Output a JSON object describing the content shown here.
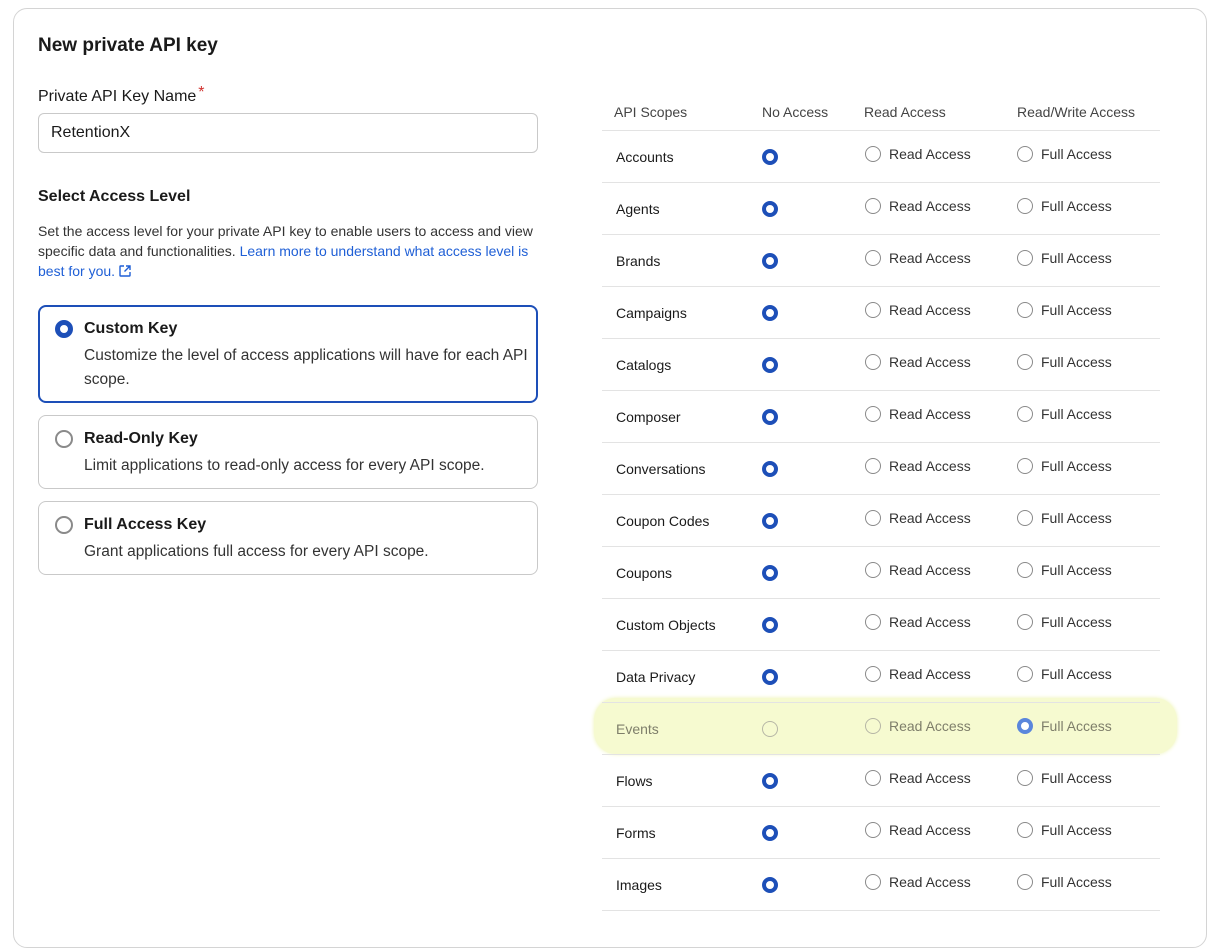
{
  "dialog": {
    "title": "New private API key"
  },
  "name_field": {
    "label": "Private API Key Name",
    "required_mark": "*",
    "value": "RetentionX"
  },
  "access_level": {
    "title": "Select Access Level",
    "description": "Set the access level for your private API key to enable users to access and view specific data and functionalities. ",
    "learn_more_link": "Learn more to understand what access level is best for you.",
    "options": [
      {
        "title": "Custom Key",
        "description": "Customize the level of access applications will have for each API scope.",
        "selected": true
      },
      {
        "title": "Read-Only Key",
        "description": "Limit applications to read-only access for every API scope.",
        "selected": false
      },
      {
        "title": "Full Access Key",
        "description": "Grant applications full access for every API scope.",
        "selected": false
      }
    ]
  },
  "scopes_table": {
    "headers": [
      "API Scopes",
      "No Access",
      "Read Access",
      "Read/Write Access"
    ],
    "read_label": "Read Access",
    "full_label": "Full Access",
    "rows": [
      {
        "scope": "Accounts",
        "selected": "none"
      },
      {
        "scope": "Agents",
        "selected": "none"
      },
      {
        "scope": "Brands",
        "selected": "none"
      },
      {
        "scope": "Campaigns",
        "selected": "none"
      },
      {
        "scope": "Catalogs",
        "selected": "none"
      },
      {
        "scope": "Composer",
        "selected": "none"
      },
      {
        "scope": "Conversations",
        "selected": "none"
      },
      {
        "scope": "Coupon Codes",
        "selected": "none"
      },
      {
        "scope": "Coupons",
        "selected": "none"
      },
      {
        "scope": "Custom Objects",
        "selected": "none"
      },
      {
        "scope": "Data Privacy",
        "selected": "none"
      },
      {
        "scope": "Events",
        "selected": "full",
        "highlighted": true
      },
      {
        "scope": "Flows",
        "selected": "none"
      },
      {
        "scope": "Forms",
        "selected": "none"
      },
      {
        "scope": "Images",
        "selected": "none"
      }
    ]
  },
  "colors": {
    "accent": "#1d4fb8",
    "link": "#1f5fd6",
    "required": "#d0312d",
    "highlight": "#f6fad0"
  }
}
